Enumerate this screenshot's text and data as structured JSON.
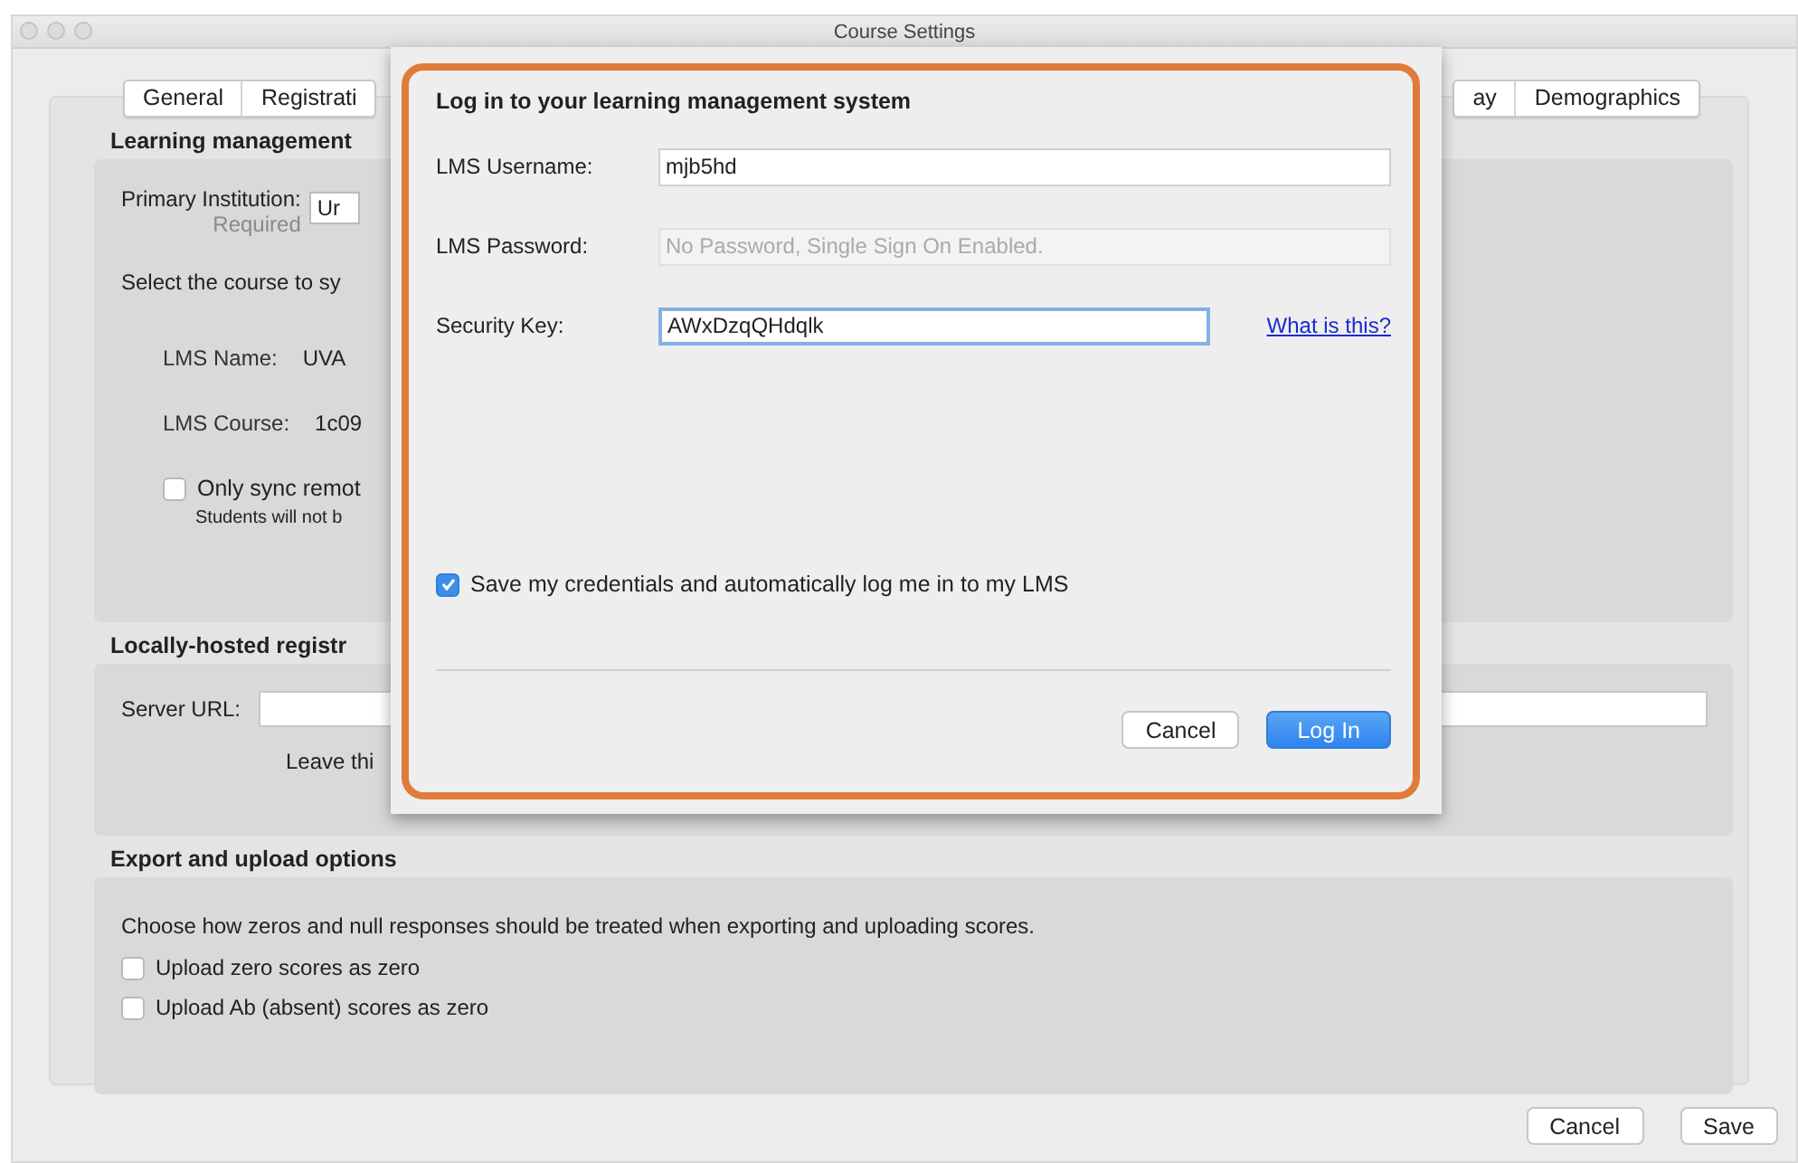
{
  "window": {
    "title": "Course Settings"
  },
  "tabs_left": [
    {
      "label": "General",
      "selected": false
    },
    {
      "label": "Registrati",
      "selected": false
    }
  ],
  "tabs_right": [
    {
      "label": "ay",
      "selected": false
    },
    {
      "label": "Demographics",
      "selected": false
    }
  ],
  "lms_section": {
    "title": "Learning management",
    "institution_label": "Primary Institution:",
    "required": "Required",
    "institution_value": "Ur",
    "select_text": "Select the course to sy",
    "name_label": "LMS Name:",
    "name_value": "UVA",
    "course_label": "LMS Course:",
    "course_value": "1c09",
    "sync_option": {
      "label": "Only sync remot",
      "checked": false
    },
    "sync_note": "Students will not b"
  },
  "local_section": {
    "title": "Locally-hosted registr",
    "url_label": "Server URL:",
    "hint": "Leave thi"
  },
  "export_section": {
    "title": "Export and upload options",
    "description": "Choose how zeros and null responses should be treated when exporting and uploading scores.",
    "options": [
      {
        "label": "Upload zero scores as zero",
        "checked": false
      },
      {
        "label": "Upload Ab (absent) scores as zero",
        "checked": false
      }
    ]
  },
  "footer_buttons": [
    "Cancel",
    "Save"
  ],
  "dialog": {
    "title": "Log in to your learning management system",
    "fields": [
      {
        "label": "LMS Username:",
        "value": "mjb5hd",
        "disabled": false,
        "focused": false
      },
      {
        "label": "LMS Password:",
        "placeholder": "No Password, Single Sign On Enabled.",
        "disabled": true,
        "focused": false
      },
      {
        "label": "Security Key:",
        "value": "AWxDzqQHdqlk",
        "disabled": false,
        "focused": true,
        "link": "What is this?"
      }
    ],
    "save_option": {
      "label": "Save my credentials and automatically log me in to my LMS",
      "checked": true
    },
    "buttons": [
      {
        "label": "Cancel",
        "kind": "secondary"
      },
      {
        "label": "Log In",
        "kind": "primary"
      }
    ]
  }
}
